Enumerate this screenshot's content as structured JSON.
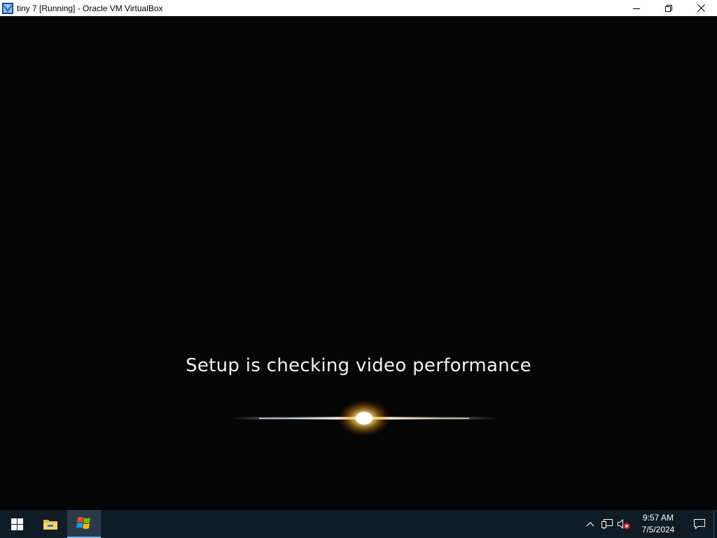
{
  "window": {
    "title": "tiny 7 [Running] - Oracle VM VirtualBox",
    "app_icon": "virtualbox-icon",
    "controls": [
      "minimize-icon",
      "restore-icon",
      "close-icon"
    ]
  },
  "vm": {
    "setup_message": "Setup is checking video performance"
  },
  "taskbar": {
    "items": [
      "start-button",
      "file-explorer",
      "windows-setup"
    ],
    "tray_icons": [
      "chevron-up-icon",
      "network-icon",
      "volume-muted-icon"
    ],
    "clock_time": "9:57 AM",
    "clock_date": "7/5/2024",
    "accent_color": "#76b9ed"
  }
}
